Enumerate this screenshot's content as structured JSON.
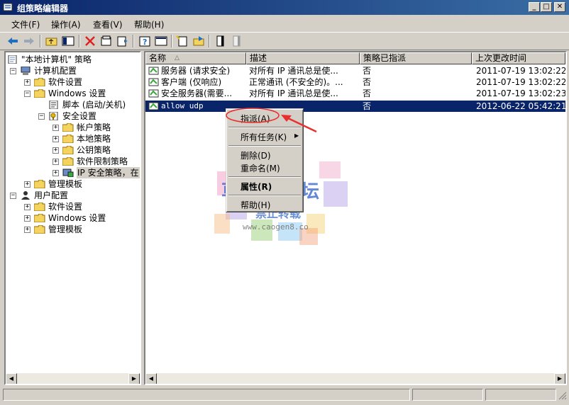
{
  "window": {
    "title": "组策略编辑器",
    "min": "_",
    "max": "□",
    "close": "✕"
  },
  "menubar": [
    "文件(F)",
    "操作(A)",
    "查看(V)",
    "帮助(H)"
  ],
  "tree": {
    "root": "\"本地计算机\" 策略",
    "computer_config": "计算机配置",
    "cc_software": "软件设置",
    "cc_windows": "Windows 设置",
    "scripts": "脚本 (启动/关机)",
    "security": "安全设置",
    "account_policy": "帐户策略",
    "local_policy": "本地策略",
    "pubkey_policy": "公钥策略",
    "software_restriction": "软件限制策略",
    "ip_security": "IP 安全策略，在",
    "cc_admin_templates": "管理模板",
    "user_config": "用户配置",
    "uc_software": "软件设置",
    "uc_windows": "Windows 设置",
    "uc_admin_templates": "管理模板"
  },
  "list": {
    "columns": [
      "名称",
      "描述",
      "策略已指派",
      "上次更改时间"
    ],
    "sort_arrow": "△",
    "rows": [
      {
        "name": "服务器 (请求安全)",
        "desc": "对所有 IP 通讯总是使...",
        "assigned": "否",
        "modified": "2011-07-19 13:02:22"
      },
      {
        "name": "客户端 (仅响应)",
        "desc": "正常通讯 (不安全的)。...",
        "assigned": "否",
        "modified": "2011-07-19 13:02:22"
      },
      {
        "name": "安全服务器(需要...",
        "desc": "对所有 IP 通讯总是使...",
        "assigned": "否",
        "modified": "2011-07-19 13:02:23"
      },
      {
        "name": "allow udp",
        "desc": "",
        "assigned": "否",
        "modified": "2012-06-22 05:42:21"
      }
    ]
  },
  "context_menu": {
    "assign": "指派(A)",
    "all_tasks": "所有任务(K)",
    "delete": "删除(D)",
    "rename": "重命名(M)",
    "properties": "属性(R)",
    "help": "帮助(H)"
  },
  "watermark": {
    "title": "草根吧论坛",
    "subtitle": "禁止转载",
    "url": "www.caogen8.co"
  },
  "colors": {
    "title_bar": "#0a246a",
    "selection": "#0a246a",
    "highlight_ring": "#e8312f",
    "arrow": "#e8312f"
  }
}
